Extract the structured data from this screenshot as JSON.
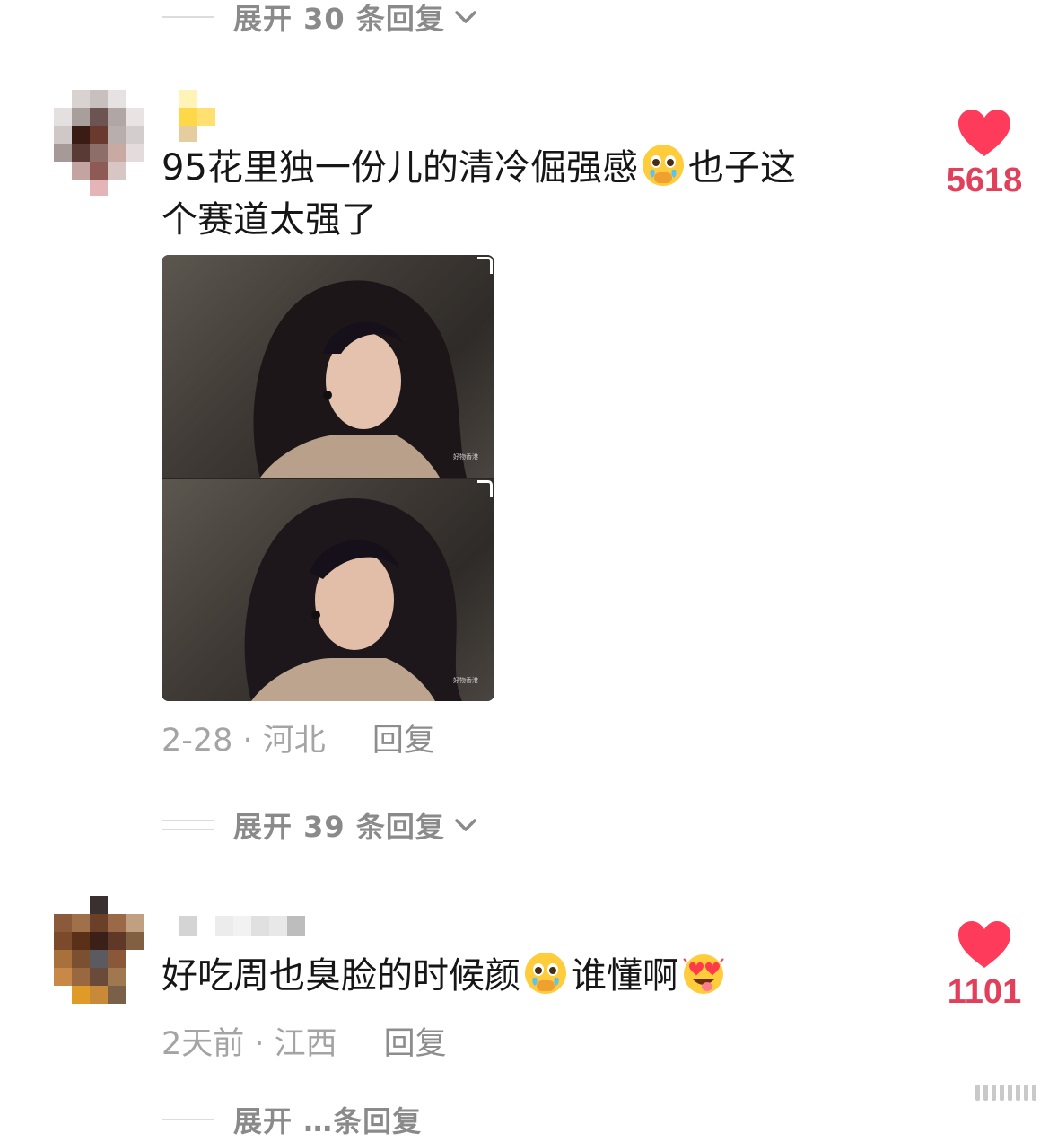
{
  "thread": {
    "expand_top": "展开 30 条回复",
    "expand_middle": "展开 39 条回复",
    "expand_bottom": "展开 …条回复"
  },
  "comments": [
    {
      "text_line1": "95花里独一份儿的清冷倔强感",
      "text_line1_tail": "也子这",
      "text_line2": "个赛道太强了",
      "emoji": [
        "holding-back-tears-emoji"
      ],
      "photo_watermark": "好物香港",
      "date_location": "2-28 · 河北",
      "reply_label": "回复",
      "likes": "5618"
    },
    {
      "text_prefix": "好吃周也臭脸的时候颜",
      "text_middle": "谁懂啊",
      "emoji": [
        "holding-back-tears-emoji",
        "heart-eyes-tongue-emoji"
      ],
      "date_location": "2天前 · 江西",
      "reply_label": "回复",
      "likes": "1101"
    }
  ],
  "colors": {
    "like_red": "#fe3b5a",
    "count_red": "#e2405a",
    "meta_grey": "#a4a4a4",
    "expand_grey": "#8a8a8a"
  },
  "icons": [
    "chevron-down-icon",
    "heart-icon",
    "reply-icon"
  ]
}
